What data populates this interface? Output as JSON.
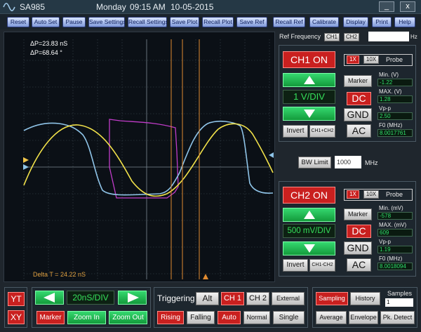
{
  "titlebar": {
    "app": "SA985",
    "day": "Monday",
    "time": "09:15 AM",
    "date": "10-05-2015",
    "minimize": "_",
    "close": "x"
  },
  "toolbar": [
    "Reset",
    "Auto Set",
    "Pause",
    "Save Settings",
    "Recall Settings",
    "Save Plot",
    "Recall Plot",
    "Save Ref",
    "Recall Ref",
    "Calibrate",
    "Display",
    "Print",
    "Help"
  ],
  "scope": {
    "delta_p1": "ΔP=23.83  nS",
    "delta_p2": "ΔP=68.64 °",
    "delta_t": "Delta T = 24.22 nS"
  },
  "ref": {
    "label": "Ref Frequency",
    "ch1": "CH1",
    "ch2": "CH2",
    "value": "",
    "unit": "Hz"
  },
  "ch1": {
    "on": "CH1 ON",
    "x1": "1X",
    "x10": "10X",
    "probe": "Probe",
    "marker": "Marker",
    "vdiv": "1 V/DIV",
    "dc": "DC",
    "gnd": "GND",
    "ac": "AC",
    "invert": "Invert",
    "math": "CH1+CH2",
    "min_label": "Min. (V)",
    "min": "-1.22",
    "max_label": "MAX. (V)",
    "max": "1.28",
    "vpp_label": "Vp-p",
    "vpp": "2.50",
    "f0_label": "F0 (MHz)",
    "f0": "8.0017761"
  },
  "bw": {
    "label": "BW Limit",
    "value": "1000",
    "unit": "MHz"
  },
  "ch2": {
    "on": "CH2 ON",
    "x1": "1X",
    "x10": "10X",
    "probe": "Probe",
    "marker": "Marker",
    "vdiv": "500 mV/DIV",
    "dc": "DC",
    "gnd": "GND",
    "ac": "AC",
    "invert": "Invert",
    "math": "CH1-CH2",
    "min_label": "Min. (mV)",
    "min": "-578",
    "max_label": "MAX. (mV)",
    "max": "609",
    "vpp_label": "Vp-p",
    "vpp": "1.19",
    "f0_label": "F0 (MHz)",
    "f0": "8.0018094"
  },
  "mode": {
    "yt": "YT",
    "xy": "XY"
  },
  "timebase": {
    "div": "20nS/DIV",
    "marker": "Marker",
    "zoom_in": "Zoom In",
    "zoom_out": "Zoom Out"
  },
  "trigger": {
    "label": "Triggering",
    "alt": "Alt",
    "ch1": "CH 1",
    "ch2": "CH 2",
    "external": "External",
    "rising": "Rising",
    "falling": "Falling",
    "auto": "Auto",
    "normal": "Normal",
    "single": "Single"
  },
  "acq": {
    "sampling": "Sampling",
    "history": "History",
    "samples_label": "Samples",
    "samples": "1",
    "average": "Average",
    "envelope": "Envelope",
    "pk_detect": "Pk. Detect"
  },
  "colors": {
    "ch1": "#f2e24a",
    "ch2": "#8fc4e8",
    "ref": "#c13cc9",
    "marker": "#e08a30"
  }
}
